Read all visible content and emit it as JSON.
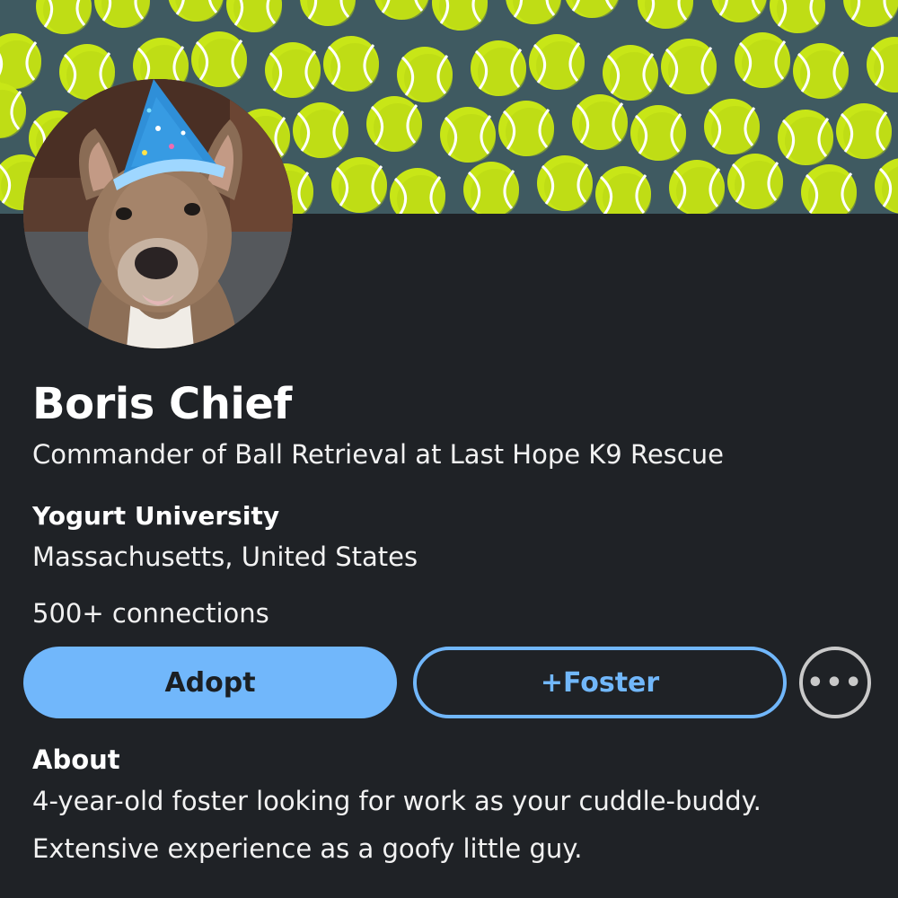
{
  "profile": {
    "name": "Boris Chief",
    "headline": "Commander of Ball Retrieval at Last Hope K9 Rescue",
    "school": "Yogurt University",
    "location": "Massachusetts, United States",
    "connections": "500+ connections"
  },
  "actions": {
    "adopt_label": "Adopt",
    "foster_label": "+Foster",
    "more_label": "•••"
  },
  "about": {
    "title": "About",
    "lines": [
      "4-year-old foster looking for work as your cuddle-buddy.",
      "Extensive experience as a goofy little guy."
    ]
  },
  "icons": {
    "banner_pattern": "tennis-ball-pattern",
    "avatar": "dog-in-party-hat-photo",
    "more": "more-options-icon"
  },
  "colors": {
    "background": "#1f2226",
    "banner": "#3f5a61",
    "tennis_ball": "#c8e617",
    "accent": "#71b7fb"
  }
}
